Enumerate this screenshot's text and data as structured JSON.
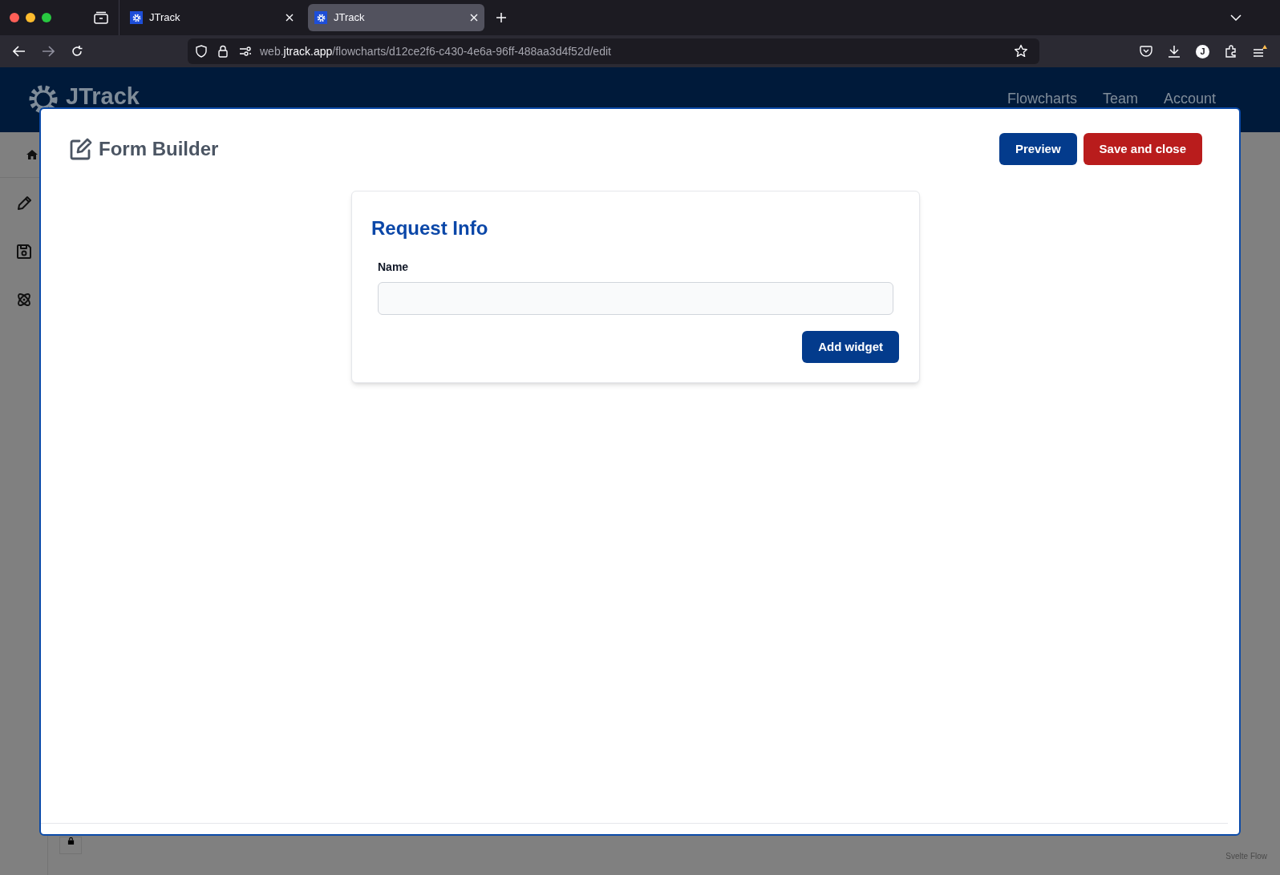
{
  "browser": {
    "tabs": [
      {
        "title": "JTrack",
        "selected": false
      },
      {
        "title": "JTrack",
        "selected": true
      }
    ],
    "url": {
      "prefix": "web.",
      "domain": "jtrack.app",
      "path": "/flowcharts/d12ce2f6-c430-4e6a-96ff-488aa3d4f52d/edit"
    },
    "account_initial": "J"
  },
  "app": {
    "logo": "JTrack",
    "nav": [
      "Flowcharts",
      "Team",
      "Account"
    ],
    "footer": "Svelte Flow"
  },
  "modal": {
    "title": "Form Builder",
    "buttons": [
      {
        "label": "Preview",
        "kind": "secondary"
      },
      {
        "label": "Save and close",
        "kind": "danger"
      }
    ],
    "form": {
      "title": "Request Info",
      "fields": [
        {
          "label": "Name"
        }
      ],
      "add_button": "Add widget"
    }
  }
}
